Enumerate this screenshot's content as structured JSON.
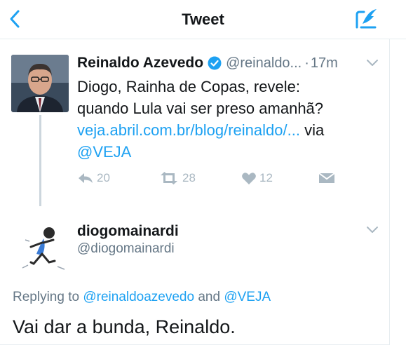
{
  "nav": {
    "title": "Tweet",
    "back_icon": "chevron-left-icon",
    "compose_icon": "compose-tweet-icon",
    "accent_color": "#1da1f2"
  },
  "original_tweet": {
    "author_name": "Reinaldo Azevedo",
    "verified": true,
    "handle": "@reinaldo...",
    "time_separator": "·",
    "time": "17m",
    "text_line1": "Diogo, Rainha de Copas, revele:",
    "text_line2": "quando Lula vai ser preso amanhã?",
    "link": "veja.abril.com.br/blog/reinaldo/...",
    "via_word": "via",
    "via_mention": "@VEJA",
    "actions": {
      "reply_count": "20",
      "retweet_count": "28",
      "like_count": "12"
    }
  },
  "reply_tweet": {
    "author_name": "diogomainardi",
    "handle": "@diogomainardi",
    "replying_prefix": "Replying to",
    "replying_mention_1": "@reinaldoazevedo",
    "replying_and": "and",
    "replying_mention_2": "@VEJA",
    "text": "Vai dar a bunda, Reinaldo."
  }
}
